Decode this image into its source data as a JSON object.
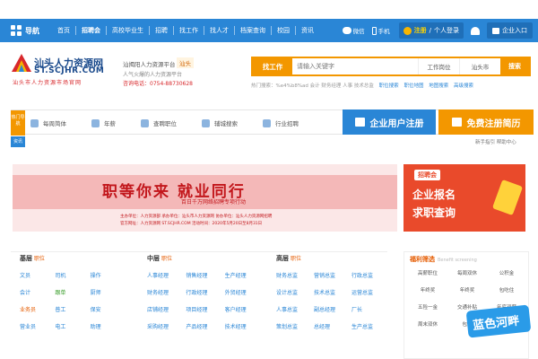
{
  "topnav": {
    "nav_label": "导航",
    "links": [
      "首页",
      "招聘会",
      "高校毕业生",
      "招聘",
      "找工作",
      "找人才",
      "档案查询",
      "校园",
      "资讯"
    ],
    "wechat": "微信",
    "mobile": "手机",
    "register": "注册",
    "personal_login": "个人登录",
    "enterprise_entry": "企业入口"
  },
  "header": {
    "logo_title": "汕头人力资源网",
    "logo_url": "ST.SCJHR.COM",
    "logo_slogan": "汕头市人力资源市场官网",
    "site_name": "汕揭阳人力资源平台",
    "city": "汕头",
    "site_sub": "人气火爆的人力资源平台",
    "tel": "咨询电话：0754-88730628"
  },
  "search": {
    "category": "找工作",
    "placeholder": "请输入关键字",
    "position_select": "工作岗位",
    "city_select": "汕头市",
    "button": "搜索",
    "hot_label": "热门搜索：%e4%b8%ad 会计 财务经理 人事 技术总监",
    "quick_links": [
      "职位搜索",
      "职位地图",
      "地图搜索",
      "高级搜索"
    ]
  },
  "subnav": {
    "hot_tag": "热门导航",
    "items": [
      "每周简体",
      "年薪",
      "查聘职位",
      "辅城搜索",
      "行业招聘"
    ],
    "enterprise_register": "企业用户注册",
    "free_resume": "免费注册简历",
    "strip_tag": "资讯",
    "strip_right": "新手指引  帮助中心"
  },
  "banner": {
    "title": "职等你来  就业同行",
    "subtitle": "百日千万网络招聘专项行动",
    "foot1": "主办单位：人力资源部  承办单位：汕头市人力资源网  协办单位：汕头人力资源网招聘  ",
    "foot2": "官方网址：人力资源网 ST.SCJHR.COM  活动时间：2020年5月20日至8月31日"
  },
  "banner2": {
    "tag": "招聘会",
    "line1": "企业报名",
    "line2": "求职查询"
  },
  "columns": [
    {
      "head": "基层",
      "head_hl": "职位",
      "items": [
        "文员",
        "司机",
        "操作",
        "会计",
        "跟单",
        "厨师",
        "业务员",
        "普工",
        "保安",
        "营业员",
        "电工",
        "助理"
      ]
    },
    {
      "head": "中层",
      "head_hl": "职位",
      "items": [
        "人事经理",
        "销售经理",
        "生产经理",
        "财务经理",
        "行政经理",
        "外贸经理",
        "店铺经理",
        "项目经理",
        "客户经理",
        "采购经理",
        "产品经理",
        "技术经理"
      ]
    },
    {
      "head": "高层",
      "head_hl": "职位",
      "items": [
        "财务总监",
        "营销总监",
        "行政总监",
        "设计总监",
        "技术总监",
        "运营总监",
        "人事总监",
        "副总经理",
        "厂长",
        "策划总监",
        "总经理",
        "生产总监"
      ]
    }
  ],
  "benefit": {
    "title": "福利筛选",
    "subtitle": "Benefit screening",
    "items": [
      "高薪职位",
      "每周双休",
      "公积金",
      "年终奖",
      "年终奖",
      "包吃住",
      "五险一金",
      "交通补贴",
      "年底双薪",
      "周末双休",
      "包住",
      "餐补"
    ]
  },
  "watermark": "蓝色河畔"
}
